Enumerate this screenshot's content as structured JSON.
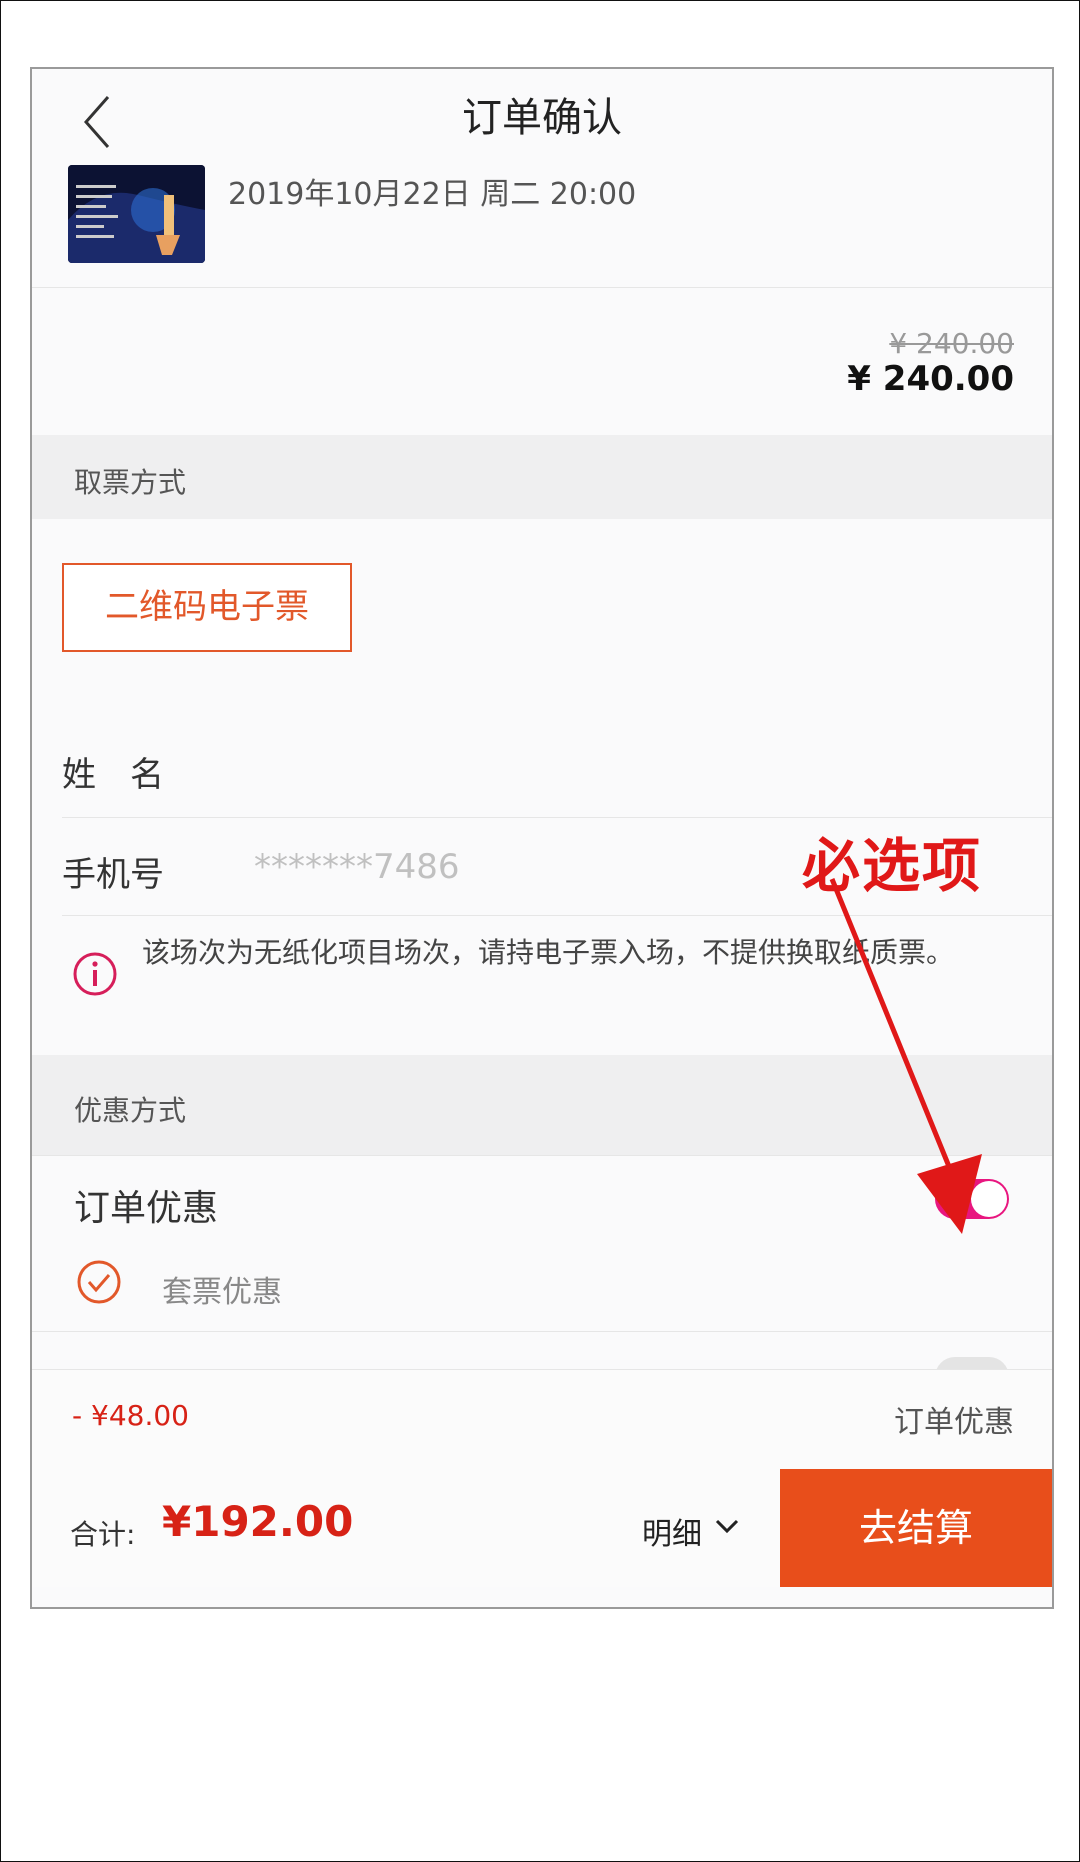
{
  "nav": {
    "title": "订单确认",
    "back_icon": "chevron-left-icon"
  },
  "event": {
    "datetime": "2019年10月22日 周二 20:00"
  },
  "price": {
    "original": "¥ 240.00",
    "current": "¥ 240.00"
  },
  "pickup": {
    "section_title": "取票方式",
    "method_label": "二维码电子票"
  },
  "form": {
    "name_label": "姓　名",
    "phone_label": "手机号",
    "phone_value": "*******7486"
  },
  "notice": {
    "text": "该场次为无纸化项目场次，请持电子票入场，不提供换取纸质票。"
  },
  "discount": {
    "section_title": "优惠方式",
    "order_discount_label": "订单优惠",
    "order_discount_enabled": true,
    "package_label": "套票优惠",
    "amount": "- ¥48.00",
    "amount_label": "订单优惠"
  },
  "footer": {
    "total_label": "合计:",
    "total_amount": "¥192.00",
    "detail_label": "明细",
    "checkout_label": "去结算"
  },
  "annotation": {
    "text": "必选项"
  },
  "colors": {
    "accent": "#e84e1b",
    "price_red": "#d72216",
    "toggle_pink": "#e8167f",
    "annotation_red": "#e01818"
  }
}
